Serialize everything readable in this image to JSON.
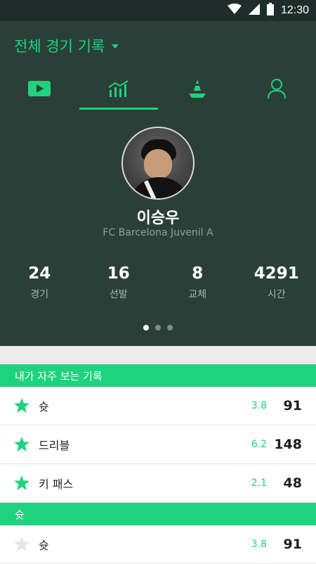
{
  "colors": {
    "accent": "#1ed37d",
    "hero_bg": "#2b3f39",
    "status_bg": "#1e2d29"
  },
  "status_bar": {
    "time": "12:30"
  },
  "header": {
    "title": "전체 경기 기록"
  },
  "tabs": [
    {
      "icon": "video-play-icon",
      "active": false
    },
    {
      "icon": "bar-chart-icon",
      "active": true
    },
    {
      "icon": "training-cone-icon",
      "active": false
    },
    {
      "icon": "person-icon",
      "active": false
    }
  ],
  "player": {
    "name": "이승우",
    "team": "FC Barcelona Juvenil A"
  },
  "stats": [
    {
      "value": "24",
      "label": "경기"
    },
    {
      "value": "16",
      "label": "선발"
    },
    {
      "value": "8",
      "label": "교체"
    },
    {
      "value": "4291",
      "label": "시간"
    }
  ],
  "pager": {
    "count": 3,
    "active_index": 0
  },
  "favorites": {
    "title": "내가 자주 보는 기록",
    "rows": [
      {
        "label": "슛",
        "avg": "3.8",
        "total": "91",
        "starred": true
      },
      {
        "label": "드리블",
        "avg": "6.2",
        "total": "148",
        "starred": true
      },
      {
        "label": "키 패스",
        "avg": "2.1",
        "total": "48",
        "starred": true
      }
    ]
  },
  "shots": {
    "title": "슛",
    "rows": [
      {
        "label": "슛",
        "avg": "3.8",
        "total": "91",
        "starred": false
      }
    ]
  }
}
